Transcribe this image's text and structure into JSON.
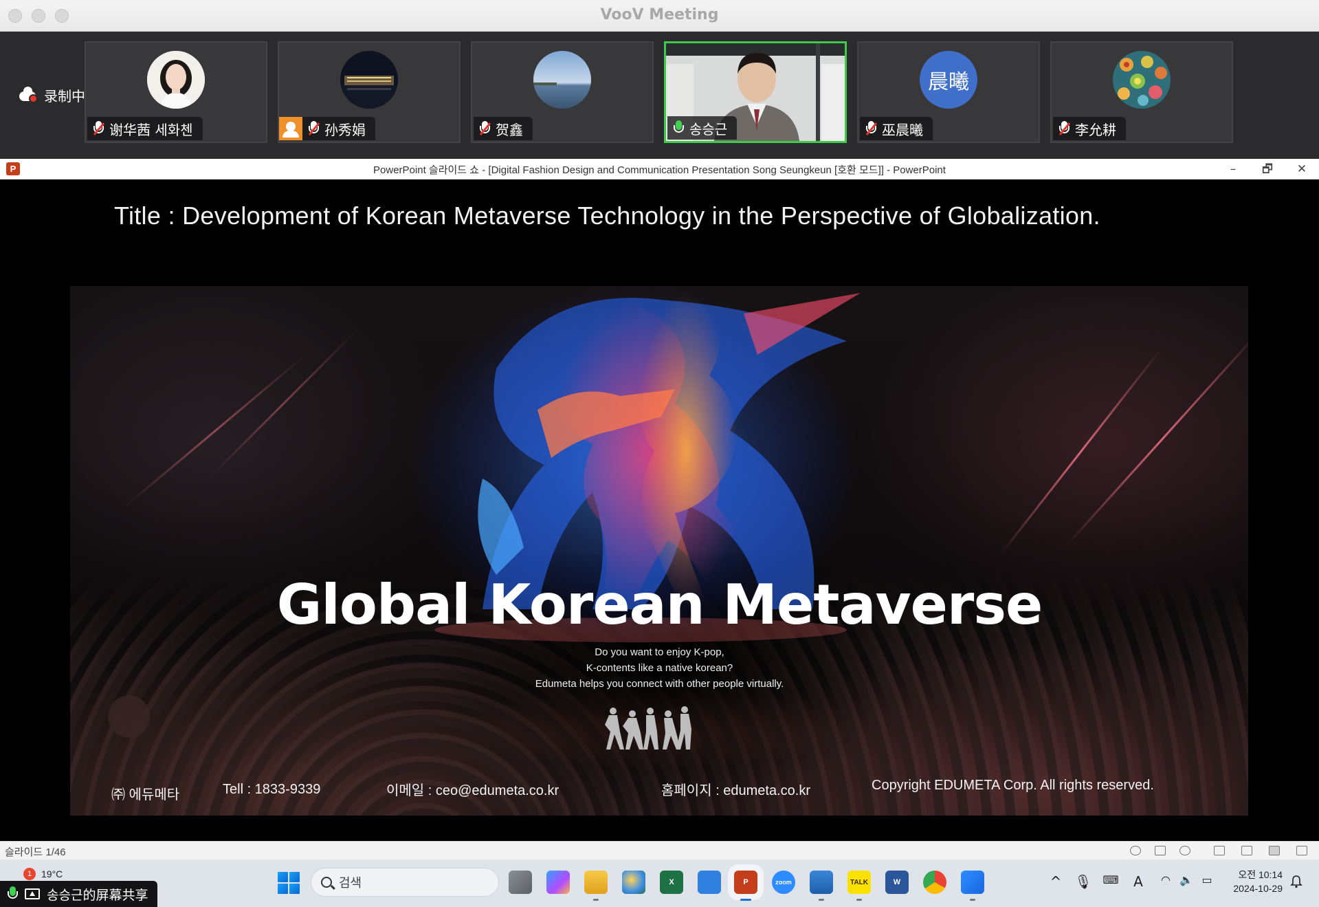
{
  "app": {
    "title": "VooV Meeting"
  },
  "recording": {
    "label": "录制中"
  },
  "participants": [
    {
      "name": "谢华茜 세화첸",
      "mic": "muted",
      "host": false,
      "avatar": "portrait-woman"
    },
    {
      "name": "孙秀娟",
      "mic": "muted",
      "host": true,
      "avatar": "night-building"
    },
    {
      "name": "贺鑫",
      "mic": "muted",
      "host": false,
      "avatar": "sea-landscape"
    },
    {
      "name": "송승근",
      "mic": "on",
      "host": false,
      "avatar": "video-feed",
      "active": true
    },
    {
      "name": "巫晨曦",
      "mic": "muted",
      "host": false,
      "avatar": "initials",
      "initials": "晨曦"
    },
    {
      "name": "李允耕",
      "mic": "muted",
      "host": false,
      "avatar": "pattern"
    }
  ],
  "powerpoint": {
    "window_title": "PowerPoint 슬라이드 쇼 - [Digital Fashion Design and Communication Presentation  Song Seungkeun [호환 모드]] - PowerPoint",
    "controls": {
      "minimize": "–",
      "restore": "🗗",
      "close": "✕"
    },
    "slide": {
      "title": "Title : Development of Korean Metaverse Technology in the Perspective of Globalization.",
      "headline": "Global Korean Metaverse",
      "tagline": [
        "Do you want to enjoy K-pop,",
        "K-contents like a native korean?",
        "Edumeta helps you connect with other people virtually."
      ],
      "footer": {
        "company": "㈜ 에듀메타",
        "tel": "Tell : 1833-9339",
        "email": "이메일  : ceo@edumeta.co.kr",
        "homepage": "홈페이지 : edumeta.co.kr",
        "copyright": "Copyright EDUMETA Corp. All rights reserved."
      }
    },
    "status": {
      "slide_count": "슬라이드 1/46"
    }
  },
  "taskbar": {
    "weather": {
      "temp": "19°C",
      "alert_count": "1"
    },
    "share": {
      "label": "송승근的屏幕共享"
    },
    "search_placeholder": "검색",
    "apps": [
      "task-view",
      "copilot",
      "file-explorer",
      "paint",
      "excel",
      "bandizip",
      "powerpoint",
      "zoom",
      "notepad",
      "kakaotalk",
      "word",
      "chrome",
      "voov-meeting"
    ],
    "app_labels": {
      "zoom": "zoom",
      "kakaotalk": "TALK",
      "excel": "X",
      "word": "W",
      "powerpoint": "P"
    },
    "clock": {
      "time": "오전 10:14",
      "date": "2024-10-29"
    },
    "tray": {
      "ime": "A"
    }
  },
  "colors": {
    "active_tile": "#3fcb4a",
    "mute_slash": "#e5352d",
    "host_badge": "#f0902a"
  }
}
